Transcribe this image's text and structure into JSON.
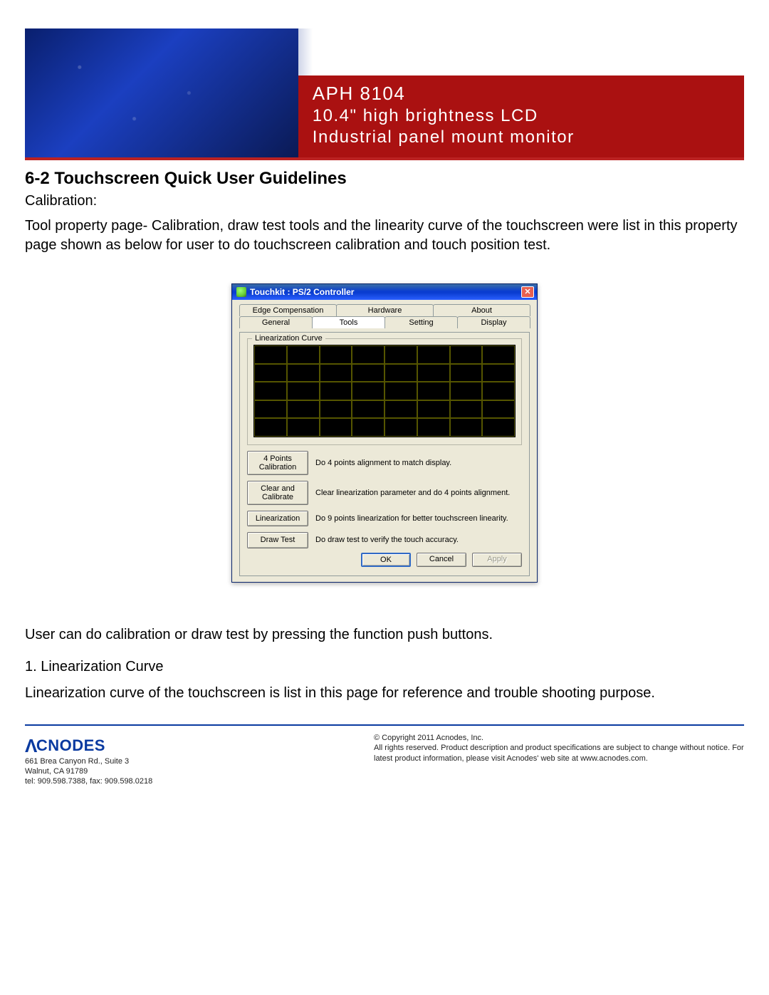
{
  "banner": {
    "line1": "APH 8104",
    "line2": "10.4\" high brightness LCD",
    "line3": "Industrial panel mount monitor"
  },
  "doc": {
    "section_title": "6-2  Touchscreen Quick User Guidelines",
    "subhead": "Calibration:",
    "para1": "Tool property page- Calibration, draw test tools and the linearity curve of the touchscreen were list in this property page shown as below for user to do touchscreen calibration and touch position test.",
    "para2": "User can do calibration or draw test by pressing the function push buttons.",
    "list1_title": "1. Linearization Curve",
    "list1_body": "Linearization curve of the touchscreen is list in this page for reference and trouble shooting purpose."
  },
  "dialog": {
    "title": "Touchkit : PS/2 Controller",
    "tabs_top": [
      "Edge Compensation",
      "Hardware",
      "About"
    ],
    "tabs_bot": [
      "General",
      "Tools",
      "Setting",
      "Display"
    ],
    "active_tab": "Tools",
    "group_label": "Linearization Curve",
    "buttons": [
      {
        "label": "4 Points Calibration",
        "desc": "Do 4 points alignment to match display."
      },
      {
        "label": "Clear and Calibrate",
        "desc": "Clear linearization parameter and do 4 points alignment."
      },
      {
        "label": "Linearization",
        "desc": "Do 9 points linearization for better touchscreen linearity."
      },
      {
        "label": "Draw Test",
        "desc": "Do draw test to verify the touch accuracy."
      }
    ],
    "footer": {
      "ok": "OK",
      "cancel": "Cancel",
      "apply": "Apply"
    }
  },
  "footer": {
    "logo": "CNODES",
    "addr1": "661 Brea Canyon Rd., Suite 3",
    "addr2": "Walnut, CA 91789",
    "phone": "tel: 909.598.7388, fax: 909.598.0218",
    "copy1": "© Copyright 2011 Acnodes, Inc.",
    "copy2": "All rights reserved. Product description and product specifications are subject to change without notice. For latest product information, please visit Acnodes' web site at www.acnodes.com."
  }
}
